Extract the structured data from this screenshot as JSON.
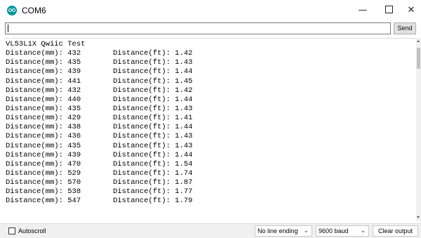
{
  "window": {
    "title": "COM6",
    "icon": "arduino-icon",
    "controls": {
      "minimize": "—",
      "maximize": "",
      "close": "✕"
    }
  },
  "input": {
    "value": "",
    "placeholder": "",
    "send_label": "Send"
  },
  "output": {
    "header": "VL53L1X Qwiic Test",
    "lines": [
      {
        "mm": "Distance(mm): 432",
        "ft": "Distance(ft): 1.42"
      },
      {
        "mm": "Distance(mm): 435",
        "ft": "Distance(ft): 1.43"
      },
      {
        "mm": "Distance(mm): 439",
        "ft": "Distance(ft): 1.44"
      },
      {
        "mm": "Distance(mm): 441",
        "ft": "Distance(ft): 1.45"
      },
      {
        "mm": "Distance(mm): 432",
        "ft": "Distance(ft): 1.42"
      },
      {
        "mm": "Distance(mm): 440",
        "ft": "Distance(ft): 1.44"
      },
      {
        "mm": "Distance(mm): 435",
        "ft": "Distance(ft): 1.43"
      },
      {
        "mm": "Distance(mm): 429",
        "ft": "Distance(ft): 1.41"
      },
      {
        "mm": "Distance(mm): 438",
        "ft": "Distance(ft): 1.44"
      },
      {
        "mm": "Distance(mm): 436",
        "ft": "Distance(ft): 1.43"
      },
      {
        "mm": "Distance(mm): 435",
        "ft": "Distance(ft): 1.43"
      },
      {
        "mm": "Distance(mm): 439",
        "ft": "Distance(ft): 1.44"
      },
      {
        "mm": "Distance(mm): 470",
        "ft": "Distance(ft): 1.54"
      },
      {
        "mm": "Distance(mm): 529",
        "ft": "Distance(ft): 1.74"
      },
      {
        "mm": "Distance(mm): 570",
        "ft": "Distance(ft): 1.87"
      },
      {
        "mm": "Distance(mm): 538",
        "ft": "Distance(ft): 1.77"
      },
      {
        "mm": "Distance(mm): 547",
        "ft": "Distance(ft): 1.79"
      }
    ]
  },
  "footer": {
    "autoscroll_label": "Autoscroll",
    "autoscroll_checked": false,
    "line_ending": "No line ending",
    "baud": "9600 baud",
    "clear_label": "Clear output"
  }
}
